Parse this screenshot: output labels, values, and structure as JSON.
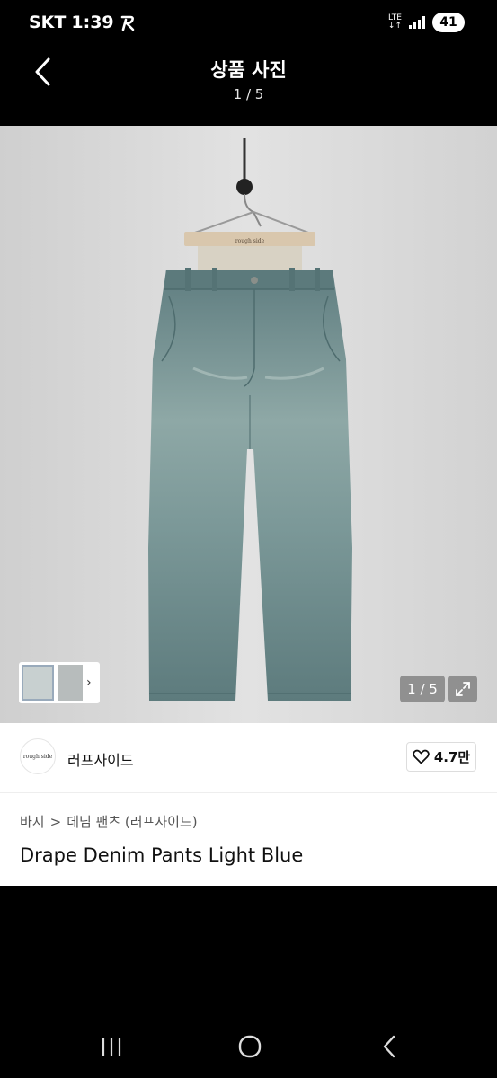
{
  "status_bar": {
    "carrier": "SKT",
    "time": "1:39",
    "network": "LTE",
    "battery": "41",
    "icons": [
      "app-notification-icon",
      "signal-icon",
      "battery-icon"
    ]
  },
  "header": {
    "title": "상품 사진",
    "counter": "1 / 5",
    "back_icon": "chevron-left-icon"
  },
  "photo": {
    "hanger_label": "rough side",
    "counter_badge": "1 / 5",
    "expand_icon": "expand-icon",
    "thumbnail_arrow": "›"
  },
  "brand": {
    "logo_text": "rough side",
    "name": "러프사이드",
    "likes": "4.7만",
    "like_icon": "heart-icon"
  },
  "breadcrumb": {
    "items": [
      "바지",
      "데님 팬츠 (러프사이드)"
    ],
    "separator": ">"
  },
  "product": {
    "name": "Drape Denim Pants Light Blue"
  },
  "nav_bar": {
    "icons": [
      "recent-apps-icon",
      "home-icon",
      "back-icon"
    ]
  },
  "colors": {
    "background": "#000000",
    "panel": "#ffffff",
    "denim": "#6f8b8c",
    "photo_bg": "#d8d8d8"
  }
}
